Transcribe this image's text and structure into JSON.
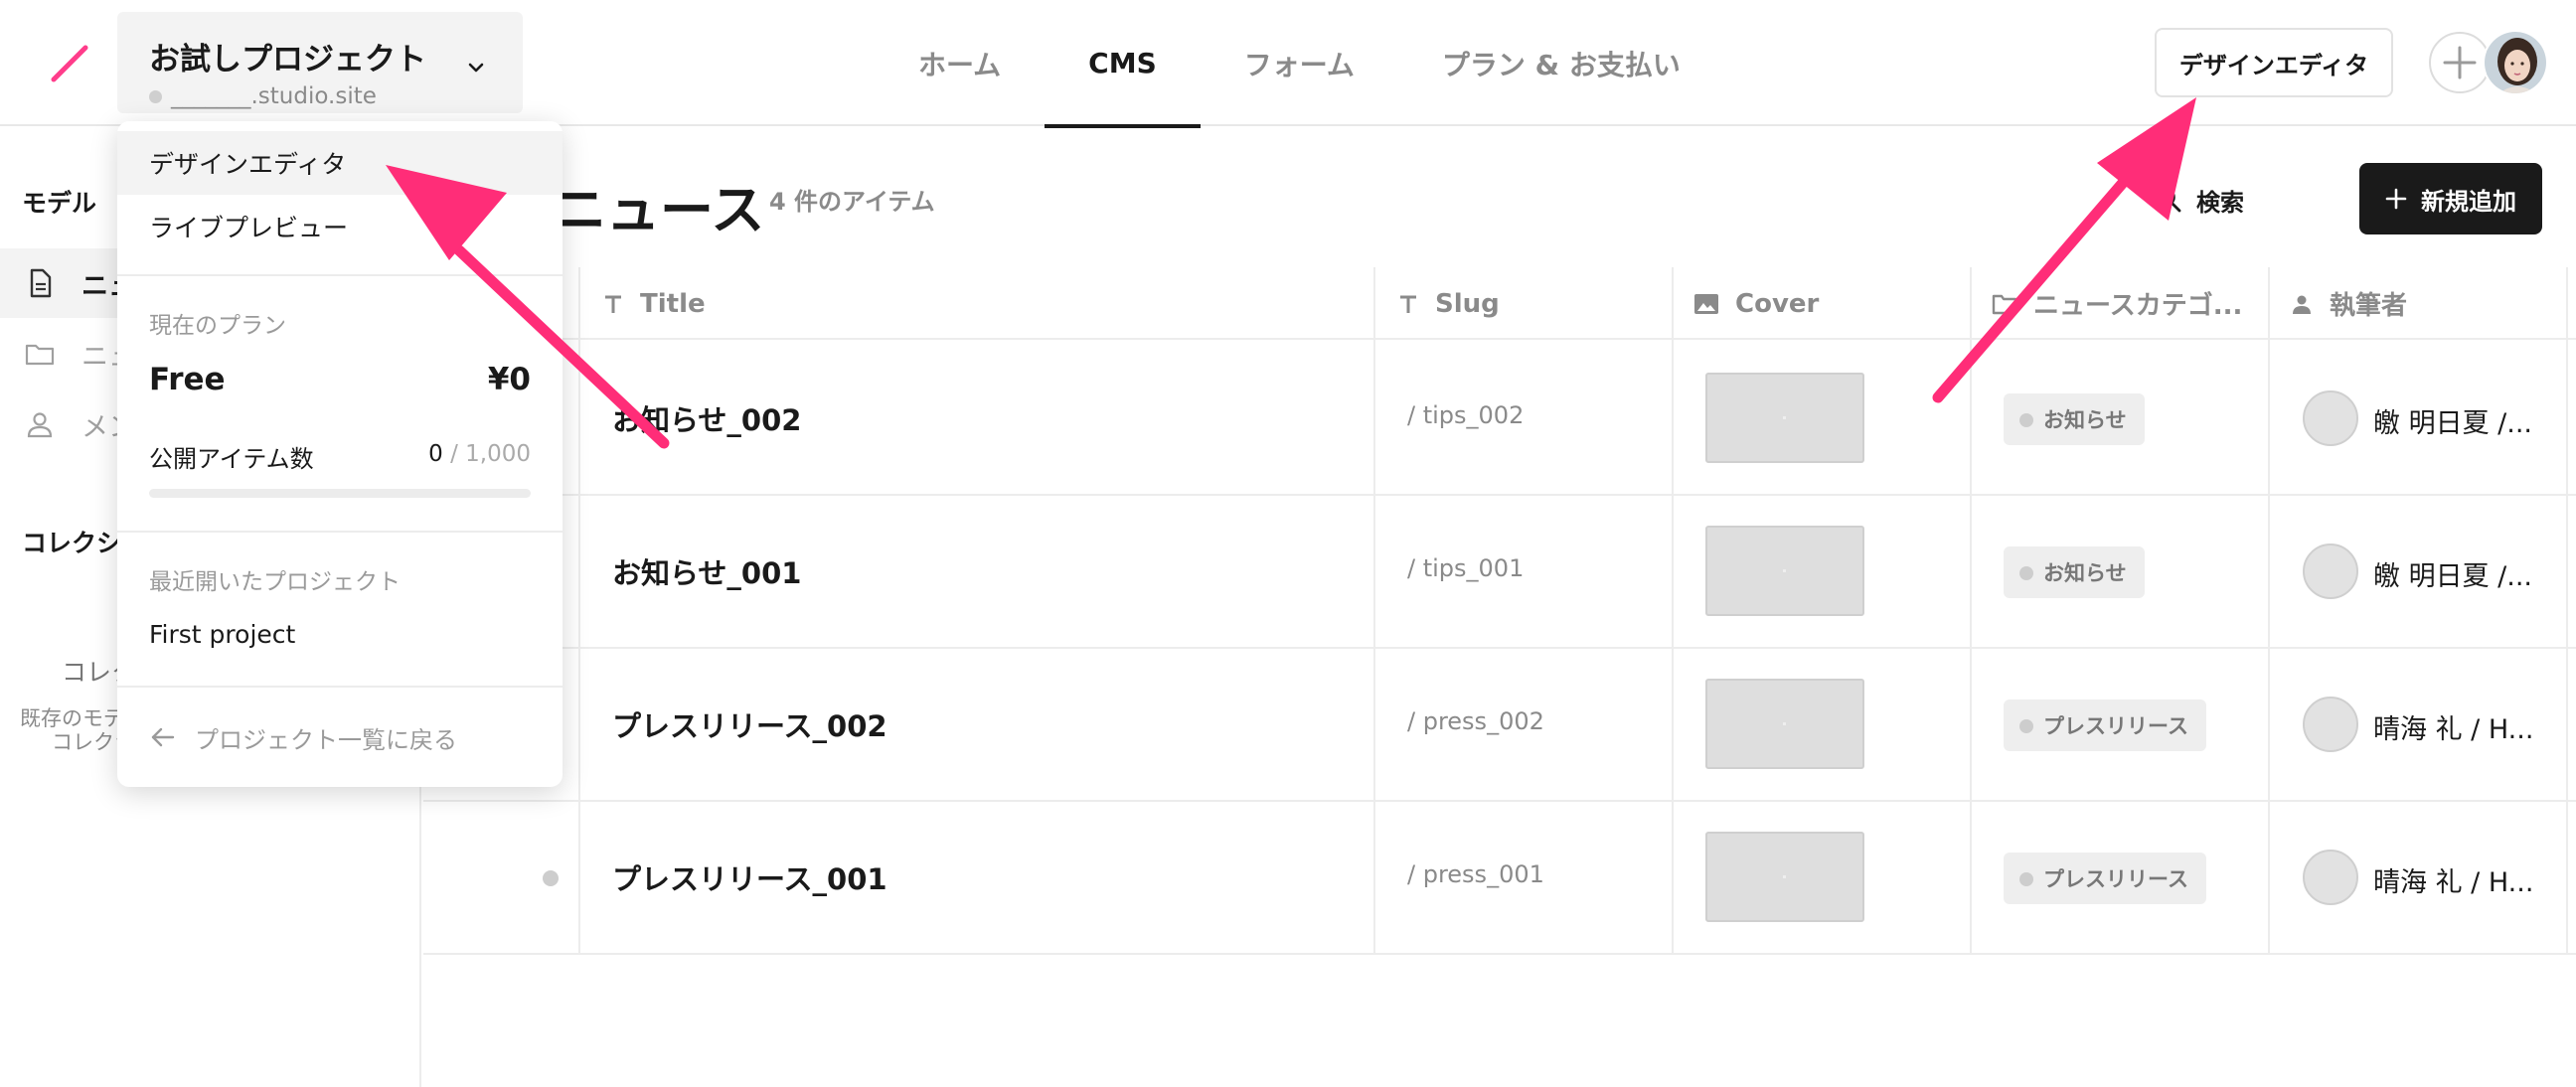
{
  "project": {
    "name": "お試しプロジェクト",
    "domain": "_______.studio.site"
  },
  "nav": {
    "tabs": [
      {
        "label": "ホーム",
        "active": false
      },
      {
        "label": "CMS",
        "active": true
      },
      {
        "label": "フォーム",
        "active": false
      },
      {
        "label": "プラン & お支払い",
        "active": false
      }
    ]
  },
  "header": {
    "design_editor_label": "デザインエディタ"
  },
  "sidebar": {
    "models_title": "モデル",
    "items": [
      {
        "label": "ニュース",
        "icon": "document-icon",
        "active": true
      },
      {
        "label": "ニュースカテゴリ",
        "icon": "folder-icon",
        "active": false
      },
      {
        "label": "メンバー",
        "icon": "person-icon",
        "active": false
      }
    ],
    "collections_title": "コレクション",
    "collections_empty": "コレクションがありません",
    "collections_desc_1": "既存のモデルからコレクションを",
    "collections_desc_2": "コレクションを作成できます"
  },
  "main": {
    "title": "ニュース",
    "item_count": "4 件のアイテム",
    "search_label": "検索",
    "add_label": "新規追加",
    "columns": [
      {
        "label": "Title",
        "icon": "text-icon"
      },
      {
        "label": "Slug",
        "icon": "text-icon"
      },
      {
        "label": "Cover",
        "icon": "image-icon"
      },
      {
        "label": "ニュースカテゴ...",
        "icon": "folder-icon"
      },
      {
        "label": "執筆者",
        "icon": "person-icon"
      }
    ],
    "rows": [
      {
        "title": "お知らせ_002",
        "slug": "/ tips_002",
        "category": "お知らせ",
        "author": "皦 明日夏 /..."
      },
      {
        "title": "お知らせ_001",
        "slug": "/ tips_001",
        "category": "お知らせ",
        "author": "皦 明日夏 /..."
      },
      {
        "title": "プレスリリース_002",
        "slug": "/ press_002",
        "category": "プレスリリース",
        "author": "晴海 礼 / H..."
      },
      {
        "title": "プレスリリース_001",
        "slug": "/ press_001",
        "category": "プレスリリース",
        "author": "晴海 礼 / H..."
      }
    ]
  },
  "dropdown": {
    "items": [
      {
        "label": "デザインエディタ",
        "hover": true
      },
      {
        "label": "ライブプレビュー",
        "hover": false
      }
    ],
    "current_plan_label": "現在のプラン",
    "plan_name": "Free",
    "plan_price": "¥0",
    "published_items_label": "公開アイテム数",
    "published_count": "0",
    "published_limit": " / 1,000",
    "published_fraction": 0,
    "recent_projects_label": "最近開いたプロジェクト",
    "recent_projects": [
      "First project"
    ],
    "back_label": "プロジェクト一覧に戻る"
  },
  "colors": {
    "accent_arrow": "#ff2d78",
    "logo": "#ff3d8b",
    "primary_button": "#1a1a1a"
  }
}
